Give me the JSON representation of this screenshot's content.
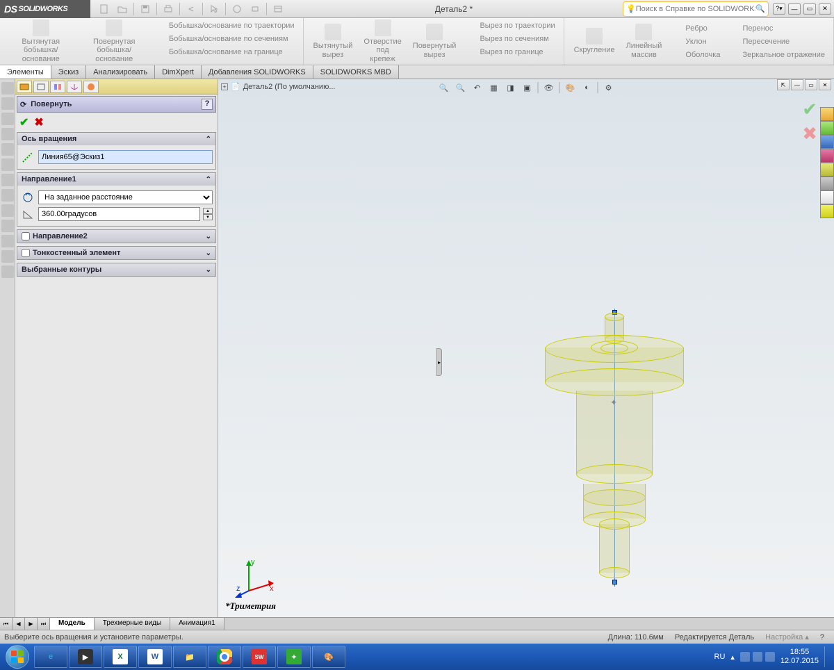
{
  "titlebar": {
    "logo_text": "SOLIDWORKS",
    "document_title": "Деталь2 *",
    "search_placeholder": "Поиск в Справке по SOLIDWORKS"
  },
  "ribbon": {
    "extrude_boss": "Вытянутая\nбобышка/основание",
    "revolve_boss": "Повернутая\nбобышка/основание",
    "swept_boss": "Бобышка/основание по траектории",
    "loft_boss": "Бобышка/основание по сечениям",
    "boundary_boss": "Бобышка/основание на границе",
    "extrude_cut": "Вытянутый\nвырез",
    "hole_wizard": "Отверстие\nпод\nкрепеж",
    "revolve_cut": "Повернутый\nвырез",
    "swept_cut": "Вырез по траектории",
    "loft_cut": "Вырез по сечениям",
    "boundary_cut": "Вырез по границе",
    "fillet": "Скругление",
    "pattern": "Линейный\nмассив",
    "rib": "Ребро",
    "draft": "Уклон",
    "shell": "Оболочка",
    "move": "Перенос",
    "intersect": "Пересечение",
    "mirror": "Зеркальное отражение"
  },
  "cmdtabs": {
    "features": "Элементы",
    "sketch": "Эскиз",
    "analyze": "Анализировать",
    "dimxpert": "DimXpert",
    "addins": "Добавления SOLIDWORKS",
    "mbd": "SOLIDWORKS MBD"
  },
  "propmgr": {
    "title": "Повернуть",
    "axis_section": "Ось вращения",
    "axis_value": "Линия65@Эскиз1",
    "dir1_section": "Направление1",
    "dir1_type": "На заданное расстояние",
    "dir1_angle": "360.00градусов",
    "dir2_section": "Направление2",
    "thin_section": "Тонкостенный элемент",
    "contours_section": "Выбранные контуры"
  },
  "viewport": {
    "breadcrumb": "Деталь2  (По умолчанию...",
    "triad_label": "*Триметрия",
    "triad_x": "x",
    "triad_y": "y",
    "triad_z": "z"
  },
  "bottom_tabs": {
    "model": "Модель",
    "views3d": "Трехмерные виды",
    "anim": "Анимация1"
  },
  "statusbar": {
    "hint": "Выберите ось вращения и установите параметры.",
    "length": "Длина: 110.6мм",
    "mode": "Редактируется Деталь",
    "custom": "Настройка"
  },
  "taskbar": {
    "lang": "RU",
    "time": "18:55",
    "date": "12.07.2015"
  }
}
